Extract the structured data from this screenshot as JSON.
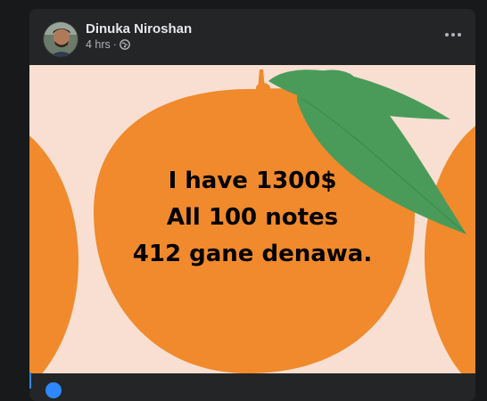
{
  "post": {
    "author": "Dinuka Niroshan",
    "time": "4 hrs",
    "separator": "·",
    "audience_icon": "globe-icon",
    "more_icon": "more-options-icon",
    "text_lines": [
      "I have 1300$",
      "All 100 notes",
      "412 gane denawa."
    ],
    "background_color": "#f8dfd2",
    "orange_color": "#f08a2c",
    "leaf_color": "#4a9b5a"
  }
}
